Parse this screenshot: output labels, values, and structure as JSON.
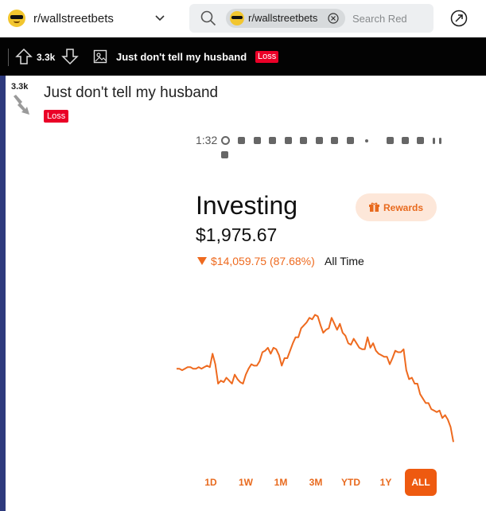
{
  "header": {
    "subreddit": "r/wallstreetbets",
    "search_chip": "r/wallstreetbets",
    "search_placeholder": "Search Red"
  },
  "postbar": {
    "score": "3.3k",
    "title": "Just don't tell my husband",
    "flair": "Loss"
  },
  "post": {
    "score": "3.3k",
    "title": "Just don't tell my husband",
    "flair": "Loss"
  },
  "phone": {
    "time": "1:32",
    "investing_label": "Investing",
    "value": "$1,975.67",
    "change": "$14,059.75 (87.68%)",
    "period_label": "All Time",
    "rewards_label": "Rewards",
    "periods": [
      "1D",
      "1W",
      "1M",
      "3M",
      "YTD",
      "1Y",
      "ALL"
    ],
    "active_period": "ALL"
  },
  "colors": {
    "accent": "#ee6a1f",
    "flair": "#ea0027",
    "postbar": "#030303"
  },
  "chart_data": {
    "type": "line",
    "x": [
      0,
      1,
      2,
      3,
      4,
      5,
      6,
      7,
      8,
      9,
      10,
      11,
      12,
      13,
      14,
      15,
      16,
      17,
      18,
      19,
      20,
      21,
      22,
      23,
      24,
      25,
      26,
      27,
      28,
      29,
      30,
      31,
      32,
      33,
      34,
      35,
      36,
      37,
      38,
      39,
      40,
      41,
      42,
      43,
      44,
      45,
      46,
      47,
      48,
      49,
      50,
      51,
      52,
      53,
      54,
      55,
      56,
      57,
      58,
      59,
      60,
      61,
      62,
      63,
      64,
      65,
      66,
      67,
      68,
      69,
      70,
      71,
      72,
      73,
      74,
      75,
      76,
      77,
      78,
      79,
      80,
      81,
      82,
      83,
      84,
      85,
      86,
      87,
      88,
      89,
      90,
      91,
      92,
      93,
      94,
      95,
      96,
      97,
      98,
      99,
      100
    ],
    "values": [
      60,
      60,
      59,
      60,
      61,
      61,
      60,
      60,
      61,
      60,
      61,
      62,
      61,
      70,
      63,
      50,
      52,
      51,
      54,
      52,
      50,
      56,
      53,
      51,
      50,
      56,
      60,
      63,
      62,
      62,
      65,
      71,
      72,
      74,
      70,
      74,
      73,
      69,
      62,
      67,
      67,
      72,
      77,
      81,
      81,
      87,
      89,
      91,
      94,
      93,
      96,
      95,
      89,
      84,
      86,
      87,
      94,
      90,
      86,
      90,
      84,
      82,
      77,
      76,
      80,
      77,
      74,
      73,
      73,
      81,
      74,
      77,
      72,
      70,
      69,
      68,
      68,
      63,
      67,
      72,
      71,
      71,
      73,
      59,
      53,
      54,
      50,
      50,
      43,
      40,
      37,
      37,
      33,
      32,
      31,
      32,
      27,
      29,
      26,
      21,
      11
    ],
    "ylim": [
      0,
      100
    ]
  }
}
